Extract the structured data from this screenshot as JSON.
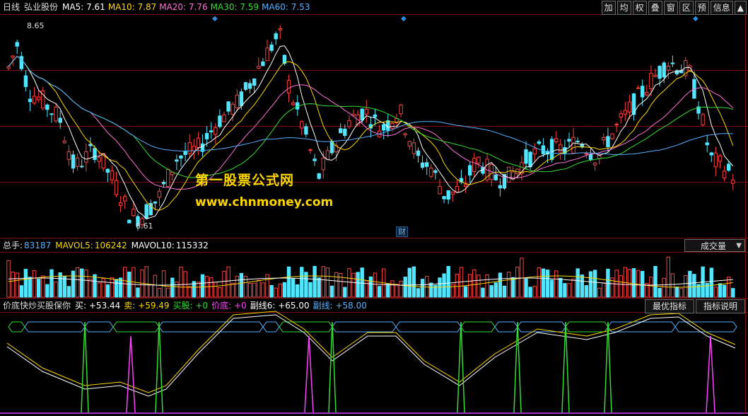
{
  "header": {
    "period": "日线",
    "stock_name": "弘业股份",
    "ma_items": [
      {
        "label": "MA5:",
        "value": "7.61",
        "color": "#ffffff"
      },
      {
        "label": "MA10:",
        "value": "7.87",
        "color": "#ffd700"
      },
      {
        "label": "MA20:",
        "value": "7.76",
        "color": "#ff6fd8"
      },
      {
        "label": "MA30:",
        "value": "7.59",
        "color": "#33dd33"
      },
      {
        "label": "MA60:",
        "value": "7.53",
        "color": "#55b0ff"
      }
    ],
    "buttons": [
      "加",
      "均",
      "权",
      "叠",
      "窗",
      "区",
      "预",
      "信息",
      "▲"
    ]
  },
  "price_chart": {
    "high_label": "8.65",
    "low_label": "6.61",
    "watermark_cn": "第一股票公式网",
    "watermark_url": "www.chnmoney.com",
    "fin_marker": "财",
    "colors": {
      "up": "#ff4040",
      "down": "#50e6ff",
      "ma5": "#ffffff",
      "ma10": "#ffd700",
      "ma20": "#ff6fd8",
      "ma30": "#33dd33",
      "ma60": "#55b0ff",
      "grid": "#7a1010"
    }
  },
  "volume_panel": {
    "total_label": "总手:",
    "total_value": "83187",
    "mavol5_label": "MAVOL5:",
    "mavol5_value": "106242",
    "mavol10_label": "MAVOL10:",
    "mavol10_value": "115332",
    "indicator_select": "成交量",
    "colors": {
      "total": "#55b0ff",
      "mavol5": "#ffd700",
      "mavol10": "#ffffff"
    }
  },
  "indicator_panel": {
    "name": "价底快炒买股保你",
    "items": [
      {
        "label": "买:",
        "value": "+53.44",
        "color": "#ffffff"
      },
      {
        "label": "卖:",
        "value": "+59.49",
        "color": "#ffd700"
      },
      {
        "label": "买股:",
        "value": "+0",
        "color": "#33dd33"
      },
      {
        "label": "价底:",
        "value": "+0",
        "color": "#ff44ff"
      },
      {
        "label": "副线6:",
        "value": "+65.00",
        "color": "#ffffff"
      },
      {
        "label": "副线:",
        "value": "+58.00",
        "color": "#55b0ff"
      }
    ],
    "buttons": [
      "最优指标",
      "指标说明"
    ]
  }
}
